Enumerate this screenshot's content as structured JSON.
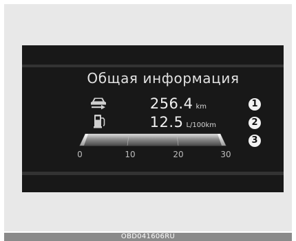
{
  "display": {
    "title": "Общая информация",
    "distance": {
      "icon": "car-range-icon",
      "value": "256.4",
      "unit": "km",
      "marker": "1"
    },
    "fuel_economy": {
      "icon": "fuel-pump-icon",
      "value": "12.5",
      "unit": "L/100km",
      "marker": "2"
    },
    "gauge": {
      "marker": "3",
      "fill_fraction": 1.0,
      "ticks": [
        "0",
        "10",
        "20",
        "30"
      ]
    }
  },
  "caption": "OBD041606RU"
}
